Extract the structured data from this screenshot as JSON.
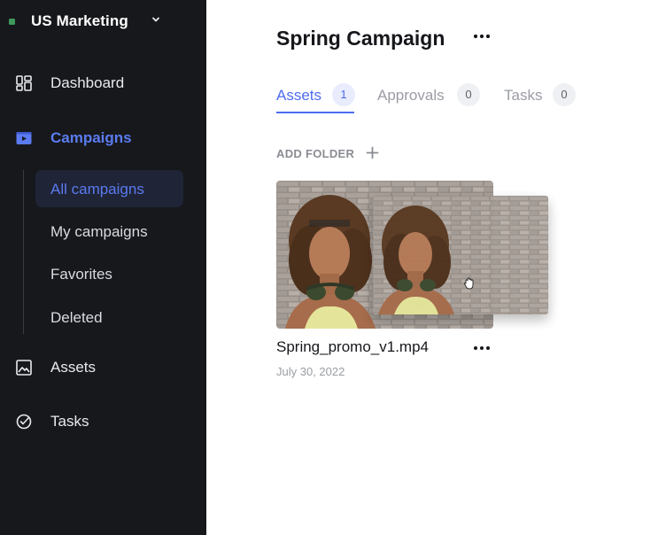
{
  "workspace": {
    "name": "US Marketing",
    "dot_color": "#3e9a5c",
    "chevron_icon": "chevron-down-icon"
  },
  "sidebar": {
    "items": [
      {
        "label": "Dashboard",
        "icon": "dashboard-icon",
        "active": false
      },
      {
        "label": "Campaigns",
        "icon": "campaigns-icon",
        "active": true
      },
      {
        "label": "Assets",
        "icon": "image-icon",
        "active": false
      },
      {
        "label": "Tasks",
        "icon": "check-circle-icon",
        "active": false
      }
    ],
    "subitems": [
      {
        "label": "All campaigns",
        "active": true
      },
      {
        "label": "My campaigns",
        "active": false
      },
      {
        "label": "Favorites",
        "active": false
      },
      {
        "label": "Deleted",
        "active": false
      }
    ],
    "accent_color": "#5b7bf0"
  },
  "main": {
    "title": "Spring Campaign",
    "more_icon": "more-horizontal-icon",
    "tabs": [
      {
        "label": "Assets",
        "count": "1",
        "active": true
      },
      {
        "label": "Approvals",
        "count": "0",
        "active": false
      },
      {
        "label": "Tasks",
        "count": "0",
        "active": false
      }
    ],
    "add_folder": {
      "label": "ADD FOLDER",
      "icon": "plus-icon"
    },
    "asset": {
      "name": "Spring_promo_v1.mp4",
      "date": "July 30, 2022",
      "more_icon": "more-horizontal-icon",
      "drag_cursor_icon": "grab-hand-icon"
    },
    "accent_color": "#4d6cf0"
  }
}
